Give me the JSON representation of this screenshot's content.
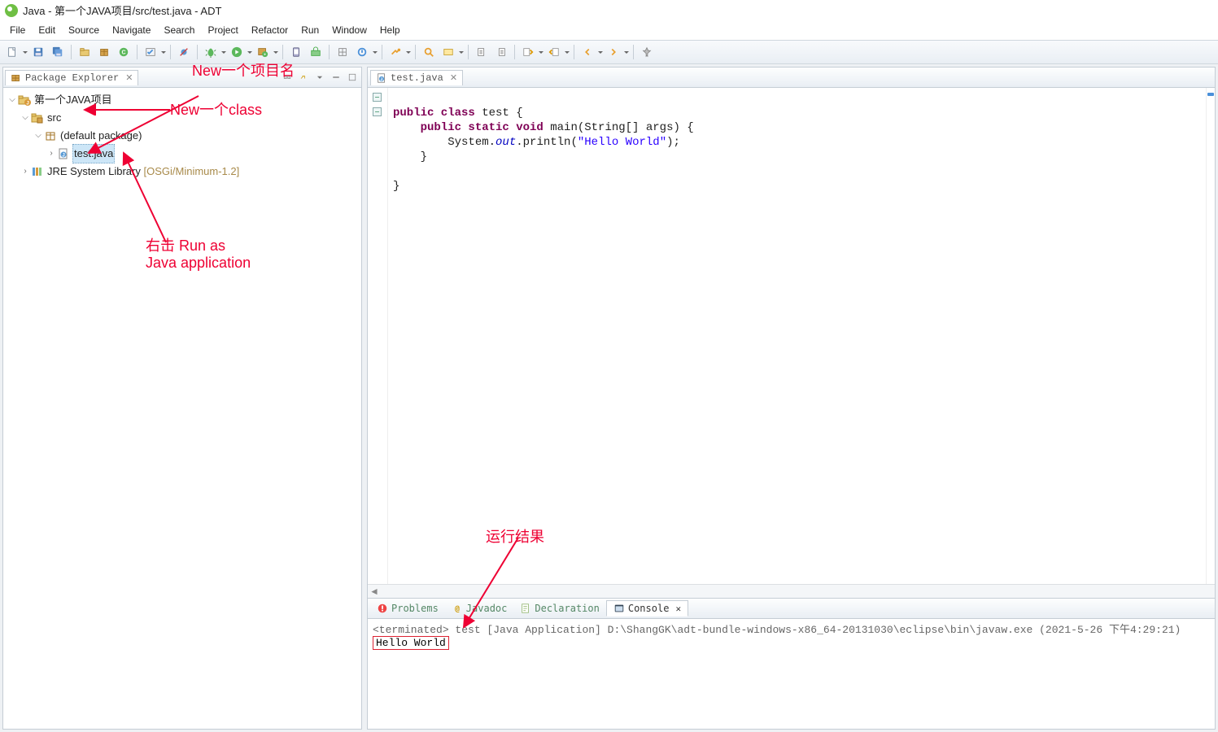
{
  "title": "Java - 第一个JAVA项目/src/test.java - ADT",
  "menus": [
    "File",
    "Edit",
    "Source",
    "Navigate",
    "Search",
    "Project",
    "Refactor",
    "Run",
    "Window",
    "Help"
  ],
  "packageExplorer": {
    "tabLabel": "Package Explorer",
    "project": "第一个JAVA项目",
    "srcFolder": "src",
    "defaultPkg": "(default package)",
    "file": "test.java",
    "jre": "JRE System Library",
    "jreQualifier": "[OSGi/Minimum-1.2]"
  },
  "editor": {
    "tabLabel": "test.java",
    "code": {
      "l1_pre": "public class",
      "l1_post": " test {",
      "l2_pre": "    public static void",
      "l2_mid": " main(String[] args) {",
      "l3_a": "        System.",
      "l3_out": "out",
      "l3_b": ".println(",
      "l3_str": "\"Hello World\"",
      "l3_c": ");",
      "l4": "    }",
      "l5": "",
      "l6": "}"
    }
  },
  "bottom": {
    "tabs": [
      "Problems",
      "Javadoc",
      "Declaration",
      "Console"
    ],
    "consoleHeader": "<terminated> test [Java Application] D:\\ShangGK\\adt-bundle-windows-x86_64-20131030\\eclipse\\bin\\javaw.exe (2021-5-26 下午4:29:21)",
    "consoleOutput": "Hello World"
  },
  "annotations": {
    "newProject": "New一个项目名",
    "newClass": "New一个class",
    "runAs1": "右击 Run as",
    "runAs2": "Java application",
    "result": "运行结果"
  }
}
